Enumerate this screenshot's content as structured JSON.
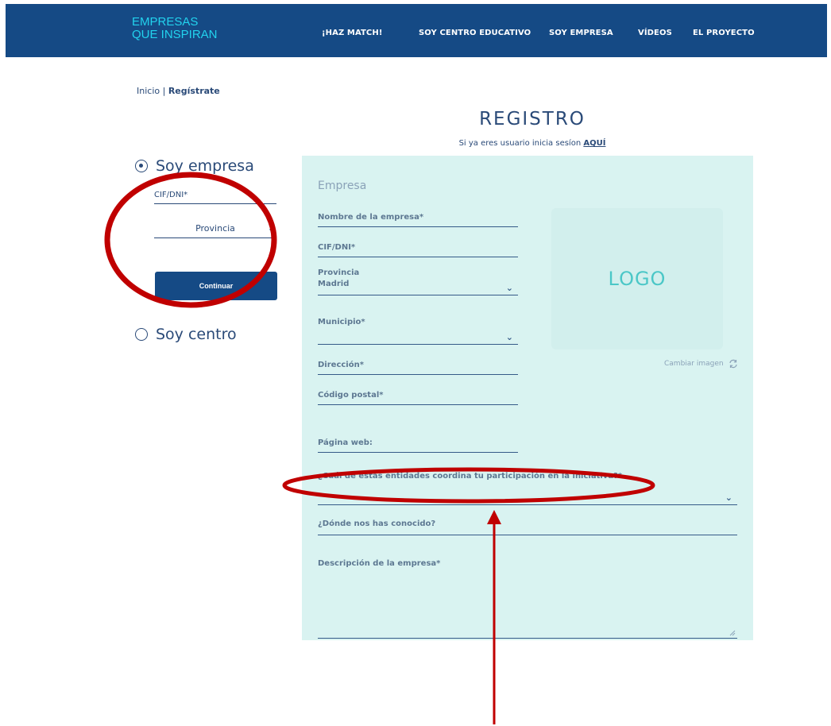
{
  "brand": {
    "line1": "EMPRESAS",
    "line2": "QUE INSPIRAN"
  },
  "nav": [
    "¡HAZ MATCH!",
    "SOY CENTRO EDUCATIVO",
    "SOY EMPRESA",
    "VÍDEOS",
    "EL PROYECTO"
  ],
  "breadcrumb": {
    "home": "Inicio",
    "separator": " | ",
    "current": "Regístrate"
  },
  "page": {
    "title": "REGISTRO",
    "login_text": "Si ya eres usuario inicia sesíon ",
    "login_link": "AQUÍ"
  },
  "left": {
    "radio_empresa": "Soy empresa",
    "cif_label": "CIF/DNI*",
    "provincia_select": "Provincia",
    "continue_button": "Continuar",
    "radio_centro": "Soy centro"
  },
  "form": {
    "section_title": "Empresa",
    "nombre": "Nombre de la empresa*",
    "cif": "CIF/DNI*",
    "provincia_label": "Provincia",
    "provincia_value": "Madrid",
    "municipio": "Municipio*",
    "direccion": "Dirección*",
    "codigo_postal": "Código postal*",
    "pagina_web": "Página web:",
    "entidades": "¿Cuál de estas entidades coordina tu participación en la iniciativa?*",
    "conocido": "¿Dónde nos has conocido?",
    "descripcion": "Descripción de la empresa*",
    "logo_placeholder": "LOGO",
    "cambiar_imagen": "Cambiar imagen"
  },
  "annotation_color": "#c00000",
  "icons": {
    "chevron": "chevron-down-icon",
    "refresh": "refresh-icon",
    "resize": "resize-handle-icon"
  }
}
